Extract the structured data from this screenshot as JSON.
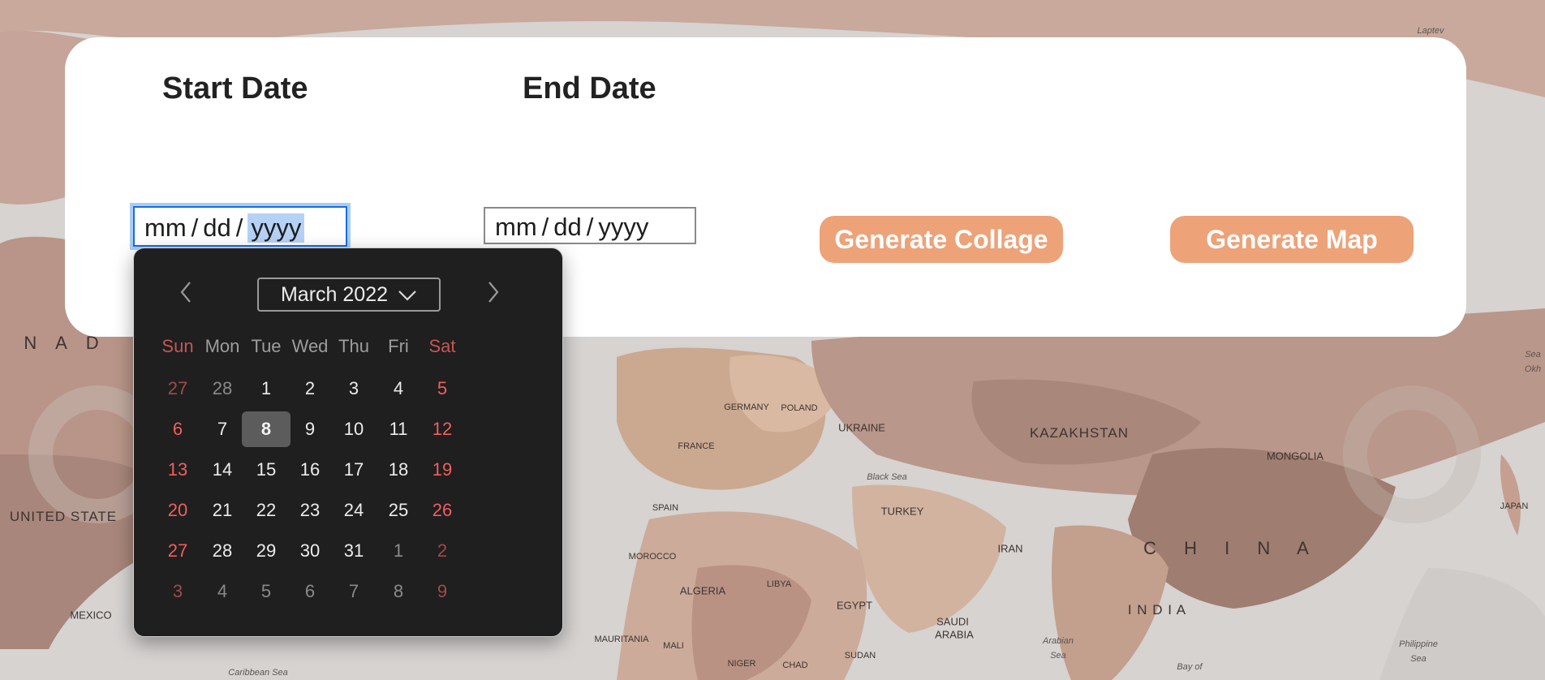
{
  "form": {
    "start_label": "Start Date",
    "end_label": "End Date",
    "start_input": {
      "mm": "mm",
      "dd": "dd",
      "yyyy": "yyyy",
      "sep": "/"
    },
    "end_input": {
      "mm": "mm",
      "dd": "dd",
      "yyyy": "yyyy",
      "sep": "/"
    },
    "generate_collage_label": "Generate Collage",
    "generate_map_label": "Generate Map"
  },
  "calendar": {
    "month_label": "March 2022",
    "weekdays": [
      "Sun",
      "Mon",
      "Tue",
      "Wed",
      "Thu",
      "Fri",
      "Sat"
    ],
    "weeks": [
      [
        {
          "d": "27",
          "m": true
        },
        {
          "d": "28",
          "m": true
        },
        {
          "d": "1"
        },
        {
          "d": "2"
        },
        {
          "d": "3"
        },
        {
          "d": "4"
        },
        {
          "d": "5"
        }
      ],
      [
        {
          "d": "6"
        },
        {
          "d": "7"
        },
        {
          "d": "8",
          "sel": true
        },
        {
          "d": "9"
        },
        {
          "d": "10"
        },
        {
          "d": "11"
        },
        {
          "d": "12"
        }
      ],
      [
        {
          "d": "13"
        },
        {
          "d": "14"
        },
        {
          "d": "15"
        },
        {
          "d": "16"
        },
        {
          "d": "17"
        },
        {
          "d": "18"
        },
        {
          "d": "19"
        }
      ],
      [
        {
          "d": "20"
        },
        {
          "d": "21"
        },
        {
          "d": "22"
        },
        {
          "d": "23"
        },
        {
          "d": "24"
        },
        {
          "d": "25"
        },
        {
          "d": "26"
        }
      ],
      [
        {
          "d": "27"
        },
        {
          "d": "28"
        },
        {
          "d": "29"
        },
        {
          "d": "30"
        },
        {
          "d": "31"
        },
        {
          "d": "1",
          "m": true
        },
        {
          "d": "2",
          "m": true
        }
      ],
      [
        {
          "d": "3",
          "m": true
        },
        {
          "d": "4",
          "m": true
        },
        {
          "d": "5",
          "m": true
        },
        {
          "d": "6",
          "m": true
        },
        {
          "d": "7",
          "m": true
        },
        {
          "d": "8",
          "m": true
        },
        {
          "d": "9",
          "m": true
        }
      ]
    ]
  },
  "map_labels": [
    {
      "text": "Laptev",
      "cls": "ml-xs ml-sea"
    },
    {
      "text": "N A D",
      "cls": "ml-lg"
    },
    {
      "text": "UNITED STATE",
      "cls": "ml-md"
    },
    {
      "text": "MEXICO",
      "cls": "ml-sm"
    },
    {
      "text": "Caribbean Sea",
      "cls": "ml-xs ml-sea"
    },
    {
      "text": "KAZAKHSTAN",
      "cls": "ml-md"
    },
    {
      "text": "MONGOLIA",
      "cls": "ml-sm"
    },
    {
      "text": "C H I N A",
      "cls": "ml-xl"
    },
    {
      "text": "JAPAN",
      "cls": "ml-xs"
    },
    {
      "text": "I N D I A",
      "cls": "ml-md"
    },
    {
      "text": "UKRAINE",
      "cls": "ml-sm"
    },
    {
      "text": "POLAND",
      "cls": "ml-xs"
    },
    {
      "text": "GERMANY",
      "cls": "ml-xs"
    },
    {
      "text": "FRANCE",
      "cls": "ml-xs"
    },
    {
      "text": "SPAIN",
      "cls": "ml-xs"
    },
    {
      "text": "Black Sea",
      "cls": "ml-xs ml-sea"
    },
    {
      "text": "TURKEY",
      "cls": "ml-sm"
    },
    {
      "text": "IRAN",
      "cls": "ml-sm"
    },
    {
      "text": "MOROCCO",
      "cls": "ml-xs"
    },
    {
      "text": "ALGERIA",
      "cls": "ml-sm"
    },
    {
      "text": "LIBYA",
      "cls": "ml-xs"
    },
    {
      "text": "EGYPT",
      "cls": "ml-sm"
    },
    {
      "text": "SAUDI",
      "cls": "ml-sm"
    },
    {
      "text": "ARABIA",
      "cls": "ml-sm"
    },
    {
      "text": "MAURITANIA",
      "cls": "ml-xs"
    },
    {
      "text": "MALI",
      "cls": "ml-xs"
    },
    {
      "text": "NIGER",
      "cls": "ml-xs"
    },
    {
      "text": "CHAD",
      "cls": "ml-xs"
    },
    {
      "text": "SUDAN",
      "cls": "ml-xs"
    },
    {
      "text": "Arabian",
      "cls": "ml-xs ml-sea"
    },
    {
      "text": "Sea",
      "cls": "ml-xs ml-sea"
    },
    {
      "text": "Bay of",
      "cls": "ml-xs ml-sea"
    },
    {
      "text": "Philippine",
      "cls": "ml-xs ml-sea"
    },
    {
      "text": "Sea",
      "cls": "ml-xs ml-sea"
    },
    {
      "text": "Sea",
      "cls": "ml-xs ml-sea"
    },
    {
      "text": "Okh",
      "cls": "ml-xs ml-sea"
    }
  ],
  "colors": {
    "accent_button": "#eda278",
    "calendar_bg": "#1f1f1f",
    "weekend_red": "#f25e5e",
    "focus_blue": "#1a6de0"
  },
  "icons": {
    "prev": "chevron-left-icon",
    "next": "chevron-right-icon",
    "month_dropdown": "chevron-down-icon"
  }
}
